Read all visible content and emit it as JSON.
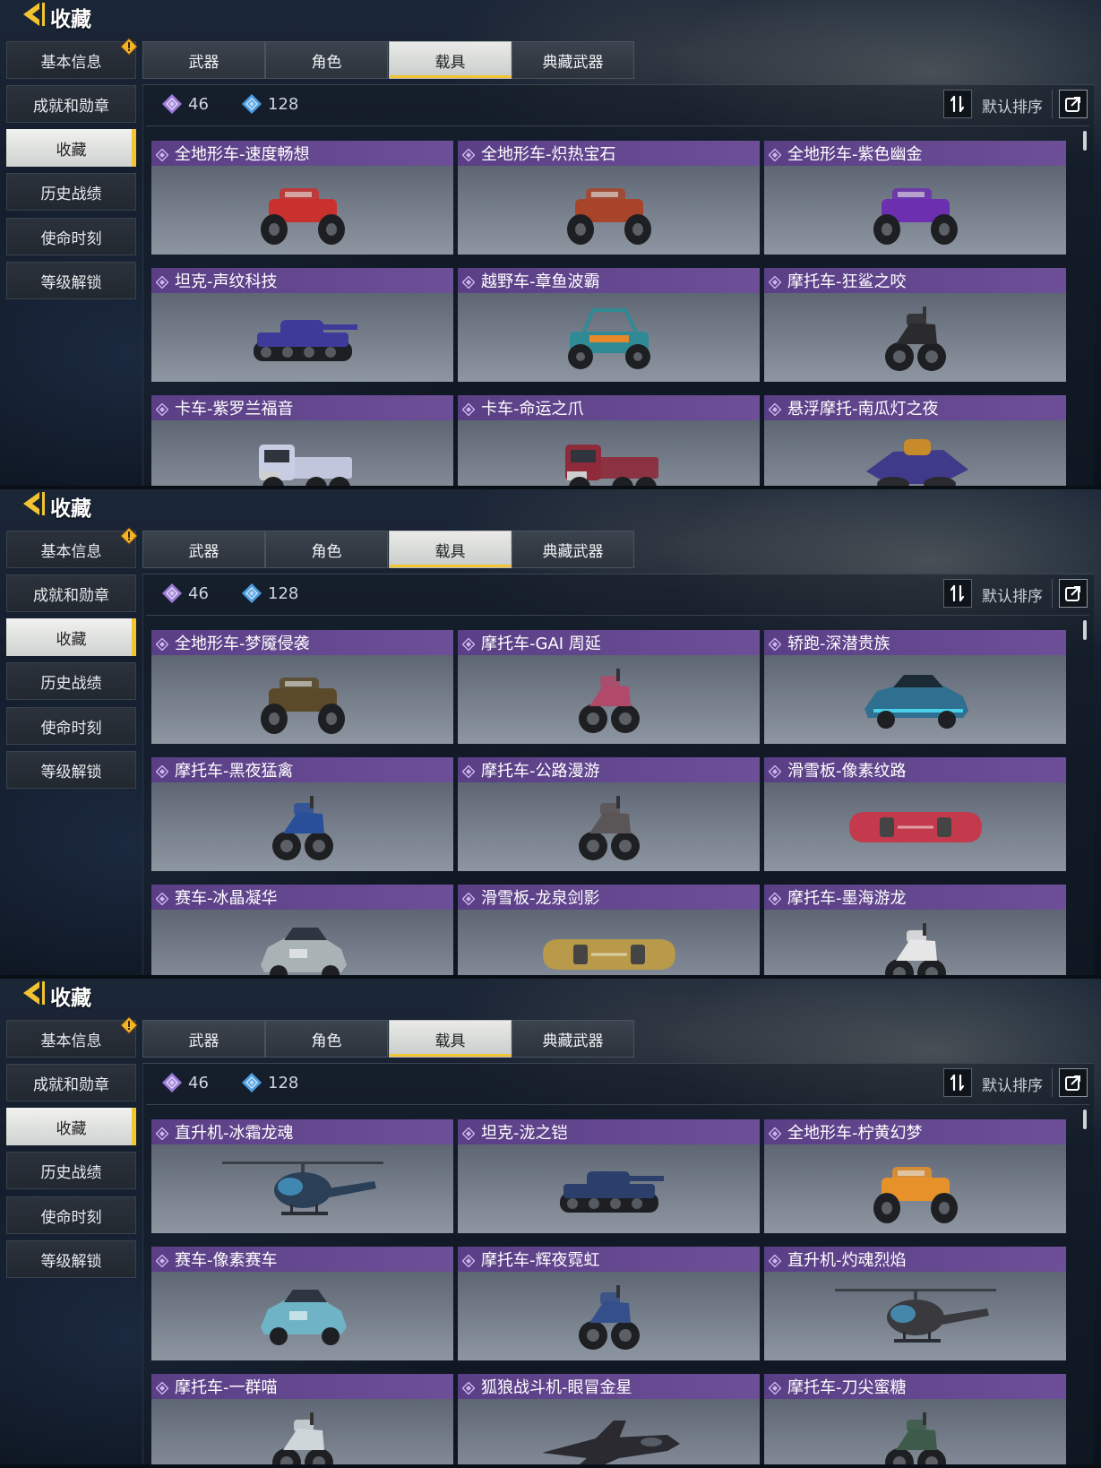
{
  "colors": {
    "accent": "#f3c431",
    "card_header": "#6a4c96",
    "purple_diamond": "#9b7ad8",
    "blue_diamond": "#4a9ee0"
  },
  "screens": [
    {
      "title": "收藏",
      "sidebar": [
        "基本信息",
        "成就和勋章",
        "收藏",
        "历史战绩",
        "使命时刻",
        "等级解锁"
      ],
      "active_side": 2,
      "tabs": [
        "武器",
        "角色",
        "载具",
        "典藏武器"
      ],
      "active_tab": 2,
      "stats": {
        "purple": "46",
        "blue": "128"
      },
      "sort_label": "默认排序",
      "cards": [
        {
          "label": "全地形车-速度畅想",
          "icon": "atv-icon",
          "color": "#c8312e"
        },
        {
          "label": "全地形车-炽热宝石",
          "icon": "atv-icon",
          "color": "#a8442a"
        },
        {
          "label": "全地形车-紫色幽金",
          "icon": "atv-icon",
          "color": "#6c2fb0"
        },
        {
          "label": "坦克-声纹科技",
          "icon": "tank-icon",
          "color": "#3d3a9a"
        },
        {
          "label": "越野车-章鱼波霸",
          "icon": "buggy-icon",
          "color": "#2f8a95"
        },
        {
          "label": "摩托车-狂鲨之咬",
          "icon": "motorcycle-icon",
          "color": "#2b2b2e"
        },
        {
          "label": "卡车-紫罗兰福音",
          "icon": "truck-icon",
          "color": "#c9cde4"
        },
        {
          "label": "卡车-命运之爪",
          "icon": "truck-icon",
          "color": "#8e2a3a"
        },
        {
          "label": "悬浮摩托-南瓜灯之夜",
          "icon": "hoverbike-icon",
          "color": "#3f3a8a"
        }
      ]
    },
    {
      "title": "收藏",
      "sidebar": [
        "基本信息",
        "成就和勋章",
        "收藏",
        "历史战绩",
        "使命时刻",
        "等级解锁"
      ],
      "active_side": 2,
      "tabs": [
        "武器",
        "角色",
        "载具",
        "典藏武器"
      ],
      "active_tab": 2,
      "stats": {
        "purple": "46",
        "blue": "128"
      },
      "sort_label": "默认排序",
      "cards": [
        {
          "label": "全地形车-梦魇侵袭",
          "icon": "atv-icon",
          "color": "#5a4a2a"
        },
        {
          "label": "摩托车-GAI 周延",
          "icon": "motorcycle-icon",
          "color": "#b0496a"
        },
        {
          "label": "轿跑-深潜贵族",
          "icon": "sports-car-icon",
          "color": "#2f6f8f"
        },
        {
          "label": "摩托车-黑夜猛禽",
          "icon": "motorcycle-icon",
          "color": "#2a4f9a"
        },
        {
          "label": "摩托车-公路漫游",
          "icon": "motorcycle-icon",
          "color": "#5a5557"
        },
        {
          "label": "滑雪板-像素纹路",
          "icon": "snowboard-icon",
          "color": "#c23a4c"
        },
        {
          "label": "赛车-冰晶凝华",
          "icon": "race-car-icon",
          "color": "#a9b2b5"
        },
        {
          "label": "滑雪板-龙泉剑影",
          "icon": "snowboard-icon",
          "color": "#b89a4a"
        },
        {
          "label": "摩托车-墨海游龙",
          "icon": "motorcycle-icon",
          "color": "#e6e6e6"
        }
      ]
    },
    {
      "title": "收藏",
      "sidebar": [
        "基本信息",
        "成就和勋章",
        "收藏",
        "历史战绩",
        "使命时刻",
        "等级解锁"
      ],
      "active_side": 2,
      "tabs": [
        "武器",
        "角色",
        "载具",
        "典藏武器"
      ],
      "active_tab": 2,
      "stats": {
        "purple": "46",
        "blue": "128"
      },
      "sort_label": "默认排序",
      "cards": [
        {
          "label": "直升机-冰霜龙魂",
          "icon": "helicopter-icon",
          "color": "#2b3f57"
        },
        {
          "label": "坦克-泷之铠",
          "icon": "tank-icon",
          "color": "#2c3f6a"
        },
        {
          "label": "全地形车-柠黄幻梦",
          "icon": "atv-icon",
          "color": "#e7912a"
        },
        {
          "label": "赛车-像素赛车",
          "icon": "race-car-icon",
          "color": "#6fb3c6"
        },
        {
          "label": "摩托车-辉夜霓虹",
          "icon": "motorcycle-icon",
          "color": "#344f8a"
        },
        {
          "label": "直升机-灼魂烈焰",
          "icon": "helicopter-icon",
          "color": "#3a3a3e"
        },
        {
          "label": "摩托车-一群喵",
          "icon": "motorcycle-icon",
          "color": "#cfd6da"
        },
        {
          "label": "狐狼战斗机-眼冒金星",
          "icon": "jet-icon",
          "color": "#2a2a30"
        },
        {
          "label": "摩托车-刀尖蜜糖",
          "icon": "motorcycle-icon",
          "color": "#3d5a4a"
        }
      ]
    }
  ]
}
